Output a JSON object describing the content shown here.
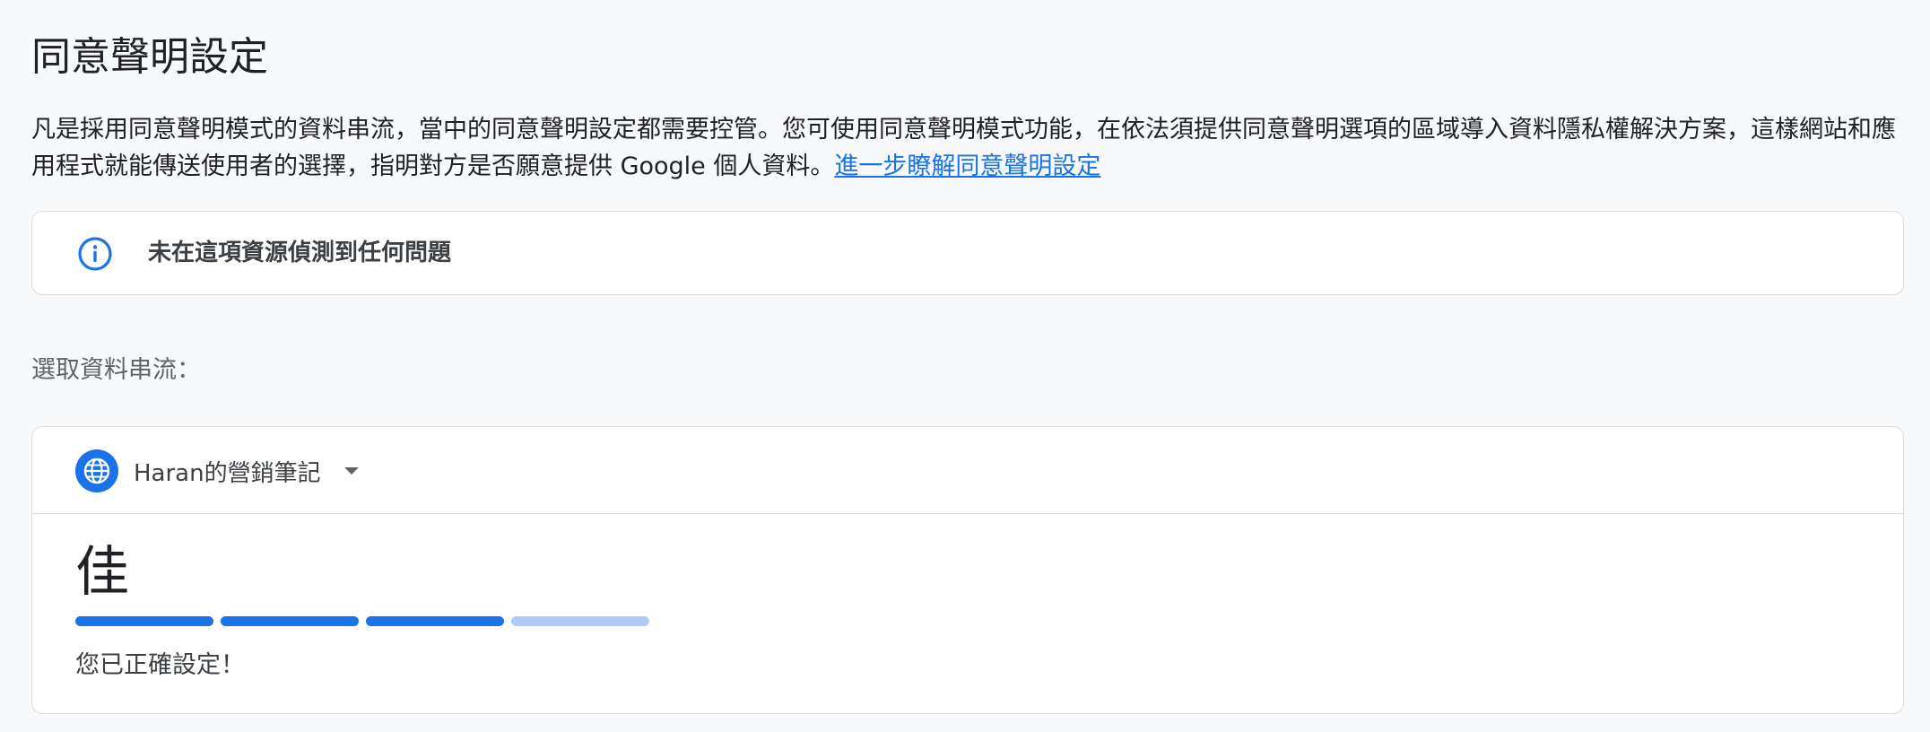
{
  "header": {
    "title": "同意聲明設定"
  },
  "description": {
    "text": "凡是採用同意聲明模式的資料串流，當中的同意聲明設定都需要控管。您可使用同意聲明模式功能，在依法須提供同意聲明選項的區域導入資料隱私權解決方案，這樣網站和應用程式就能傳送使用者的選擇，指明對方是否願意提供 Google 個人資料。",
    "link_label": "進一步瞭解同意聲明設定"
  },
  "info_banner": {
    "icon": "info-icon",
    "message": "未在這項資源偵測到任何問題"
  },
  "stream_select": {
    "label": "選取資料串流：",
    "icon": "globe-icon",
    "selected_stream": "Haran的營銷筆記"
  },
  "consent_status": {
    "grade": "佳",
    "level": 3,
    "max_level": 4,
    "message": "您已正確設定！"
  },
  "colors": {
    "accent": "#1a73e8",
    "accent_light": "#aecbfa"
  }
}
